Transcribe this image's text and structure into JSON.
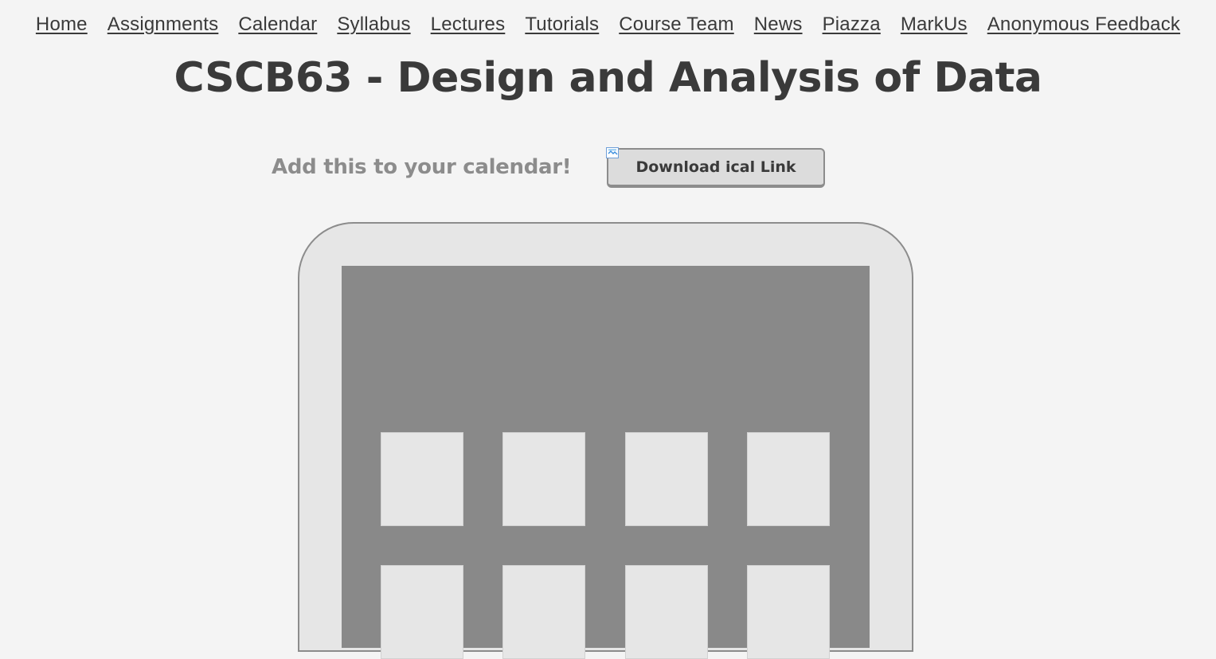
{
  "nav": {
    "items": [
      {
        "label": "Home"
      },
      {
        "label": "Assignments"
      },
      {
        "label": "Calendar"
      },
      {
        "label": "Syllabus"
      },
      {
        "label": "Lectures"
      },
      {
        "label": "Tutorials"
      },
      {
        "label": "Course Team"
      },
      {
        "label": "News"
      },
      {
        "label": "Piazza"
      },
      {
        "label": "MarkUs"
      },
      {
        "label": "Anonymous Feedback"
      }
    ]
  },
  "header": {
    "title": "CSCB63 - Design and Analysis of Data"
  },
  "calendar_section": {
    "prompt": "Add this to your calendar!",
    "download_label": "Download ical Link",
    "broken_image_icon": "broken-image-icon"
  },
  "graphic": {
    "icon": "calendar-icon",
    "colors": {
      "frame": "#e6e6e6",
      "border": "#8c8c8c",
      "panel": "#898989",
      "cell": "#e6e6e6"
    }
  },
  "colors": {
    "background": "#f4f4f4",
    "text": "#3a3a3a",
    "muted_text": "#8c8c8c",
    "button_bg": "#dcdcdc"
  }
}
